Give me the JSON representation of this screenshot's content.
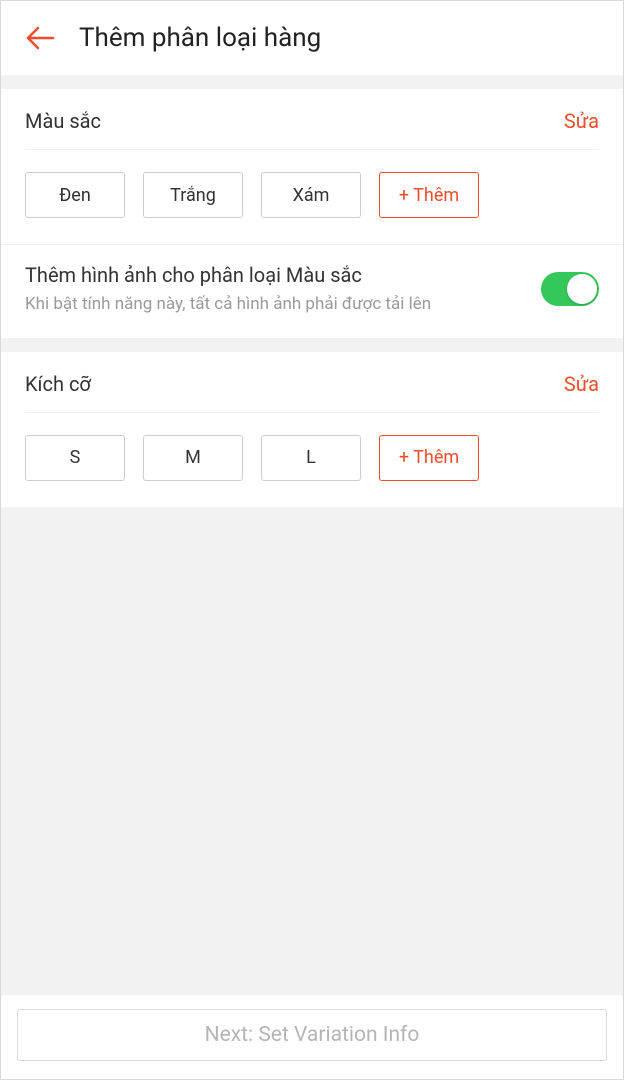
{
  "header": {
    "title": "Thêm phân loại hàng"
  },
  "colors": {
    "ee4d2d": "#ee4d2d",
    "toggle_green": "#34c759"
  },
  "sections": {
    "color": {
      "title": "Màu sắc",
      "edit": "Sửa",
      "chips": [
        "Đen",
        "Trắng",
        "Xám"
      ],
      "add": "+ Thêm",
      "image_toggle": {
        "title": "Thêm hình ảnh cho phân loại Màu sắc",
        "subtitle": "Khi bật tính năng này, tất cả hình ảnh phải được tải lên",
        "enabled": true
      }
    },
    "size": {
      "title": "Kích cỡ",
      "edit": "Sửa",
      "chips": [
        "S",
        "M",
        "L"
      ],
      "add": "+ Thêm"
    }
  },
  "footer": {
    "next": "Next: Set Variation Info"
  }
}
